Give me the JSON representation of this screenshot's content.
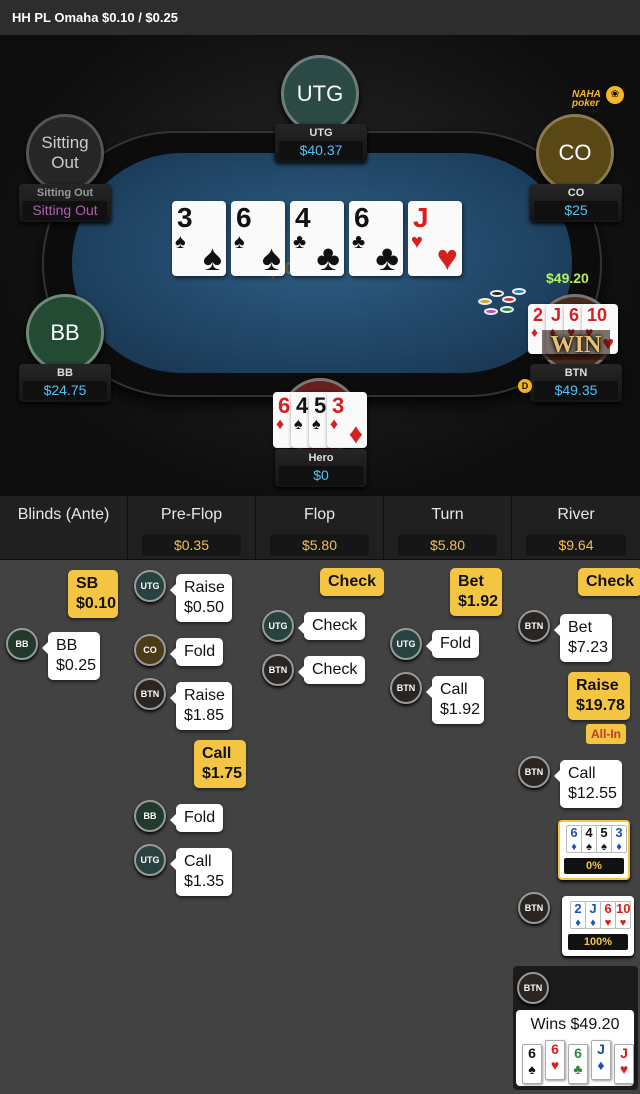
{
  "title": "HH PL Omaha $0.10 / $0.25",
  "logo": {
    "text": "NAHA poker",
    "mark": "❀"
  },
  "felt_logo": "poker",
  "seats": {
    "utg": {
      "label": "UTG",
      "name": "UTG",
      "stack": "$40.37"
    },
    "co": {
      "label": "CO",
      "name": "CO",
      "stack": "$25"
    },
    "sitting": {
      "label1": "Sitting",
      "label2": "Out",
      "name": "Sitting Out",
      "status": "Sitting Out"
    },
    "bb": {
      "label": "BB",
      "name": "BB",
      "stack": "$24.75"
    },
    "btn": {
      "name": "BTN",
      "stack": "$49.35"
    },
    "hero": {
      "name": "Hero",
      "stack": "$0"
    }
  },
  "board": [
    {
      "rank": "3",
      "suit": "♠",
      "color": "#111"
    },
    {
      "rank": "6",
      "suit": "♠",
      "color": "#111"
    },
    {
      "rank": "4",
      "suit": "♣",
      "color": "#111"
    },
    {
      "rank": "6",
      "suit": "♣",
      "color": "#111"
    },
    {
      "rank": "J",
      "suit": "♥",
      "color": "#d61f1f"
    }
  ],
  "hero_cards": [
    {
      "rank": "6",
      "suit": "♦",
      "color": "#d61f1f"
    },
    {
      "rank": "4",
      "suit": "♠",
      "color": "#111"
    },
    {
      "rank": "5",
      "suit": "♠",
      "color": "#111"
    },
    {
      "rank": "3",
      "suit": "♦",
      "color": "#d61f1f"
    }
  ],
  "btn_cards": [
    {
      "rank": "2",
      "suit": "♦",
      "color": "#d61f1f"
    },
    {
      "rank": "J",
      "suit": "♦",
      "color": "#d61f1f"
    },
    {
      "rank": "6",
      "suit": "♥",
      "color": "#d61f1f"
    },
    {
      "rank": "10",
      "suit": "♥",
      "color": "#d61f1f"
    }
  ],
  "win_amount": "$49.20",
  "win_badge": "WIN",
  "dealer_button": "D",
  "colors": {
    "felt": "#2f5f86",
    "accent_yellow": "#f4c543",
    "stack_blue": "#4fc3f7",
    "win_green": "#b6f25a"
  },
  "history": {
    "columns": [
      {
        "title": "Blinds (Ante)",
        "pot": ""
      },
      {
        "title": "Pre-Flop",
        "pot": "$0.35"
      },
      {
        "title": "Flop",
        "pot": "$5.80"
      },
      {
        "title": "Turn",
        "pot": "$5.80"
      },
      {
        "title": "River",
        "pot": "$9.64"
      }
    ],
    "positions": {
      "utg": "UTG",
      "co": "CO",
      "btn": "BTN",
      "bb": "BB"
    },
    "blinds": {
      "sb_a": "SB",
      "sb_b": "$0.10",
      "bb_a": "BB",
      "bb_b": "$0.25"
    },
    "preflop": {
      "a1": "Raise",
      "a1v": "$0.50",
      "a2": "Fold",
      "a3": "Raise",
      "a3v": "$1.85",
      "a4": "Call",
      "a4v": "$1.75",
      "a5": "Fold",
      "a6": "Call",
      "a6v": "$1.35"
    },
    "flop": {
      "a1": "Check",
      "a2": "Check",
      "a3": "Check"
    },
    "turn": {
      "a1": "Bet",
      "a1v": "$1.92",
      "a2": "Fold",
      "a3": "Call",
      "a3v": "$1.92"
    },
    "river": {
      "a1": "Check",
      "a2": "Bet",
      "a2v": "$7.23",
      "a3": "Raise",
      "a3v": "$19.78",
      "allin": "All-In",
      "a4": "Call",
      "a4v": "$12.55",
      "hero_pct": "0%",
      "btn_pct": "100%",
      "wins": "Wins $49.20"
    },
    "hero_reveal": [
      {
        "rank": "6",
        "suit": "♦",
        "color": "#1e4fbf"
      },
      {
        "rank": "4",
        "suit": "♠",
        "color": "#111"
      },
      {
        "rank": "5",
        "suit": "♠",
        "color": "#111"
      },
      {
        "rank": "3",
        "suit": "♦",
        "color": "#1e4fbf"
      }
    ],
    "btn_reveal": [
      {
        "rank": "2",
        "suit": "♦",
        "color": "#1e4fbf"
      },
      {
        "rank": "J",
        "suit": "♦",
        "color": "#1e4fbf"
      },
      {
        "rank": "6",
        "suit": "♥",
        "color": "#d61f1f"
      },
      {
        "rank": "10",
        "suit": "♥",
        "color": "#d61f1f"
      }
    ],
    "win_hand": [
      {
        "rank": "6",
        "suit": "♠",
        "color": "#111"
      },
      {
        "rank": "6",
        "suit": "♥",
        "color": "#d61f1f"
      },
      {
        "rank": "6",
        "suit": "♣",
        "color": "#2e8b3a"
      },
      {
        "rank": "J",
        "suit": "♦",
        "color": "#1e4fbf"
      },
      {
        "rank": "J",
        "suit": "♥",
        "color": "#d61f1f"
      }
    ]
  }
}
